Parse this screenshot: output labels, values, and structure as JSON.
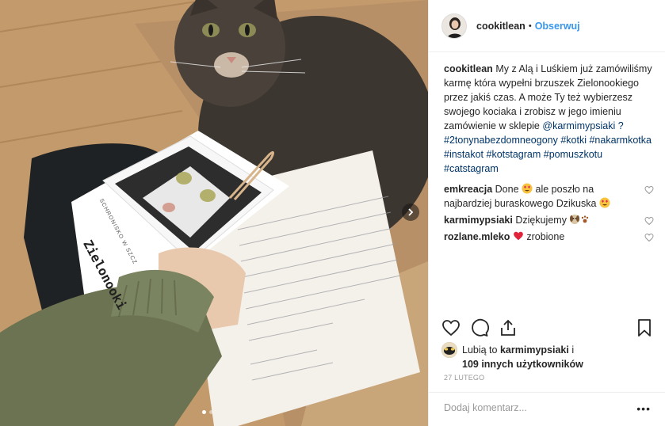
{
  "post": {
    "username": "cookitlean",
    "separator": "•",
    "follow_label": "Obserwuj",
    "caption_author": "cookitlean",
    "caption_text": "My z Alą i Luśkiem już zamówiliśmy karmę która wypełni brzuszek Zielonookiego przez jakiś czas. A może Ty też wybierzesz swojego kociaka i zrobisz w jego imieniu zamówienie w sklepie",
    "caption_tags": "@karmimypsiaki ? #2tonynabezdomneogony #kotki #nakarmkotka #instakot #kotstagram #pomuszkotu #catstagram"
  },
  "photo": {
    "card_title": "Zielonooki",
    "card_subtitle": "SCHRONISKO W SZCZ"
  },
  "comments": [
    {
      "author": "emkreacja",
      "text_before": "Done",
      "emoji1": "heart-eyes",
      "text_after": "ale poszło na najbardziej buraskowego Dzikuska",
      "emoji2": "heart-eyes"
    },
    {
      "author": "karmimypsiaki",
      "text": "Dziękujemy",
      "emoji": "dog-paws"
    },
    {
      "author": "rozlane.mleko",
      "emoji": "red-heart",
      "text": "zrobione"
    }
  ],
  "likes": {
    "prefix": "Lubią to",
    "user": "karmimypsiaki",
    "middle": "i",
    "count_text": "109 innych użytkowników"
  },
  "date": "27 LUTEGO",
  "add_comment_placeholder": "Dodaj komentarz...",
  "more_label": "•••",
  "colors": {
    "link": "#3897f0",
    "hashtag": "#003569",
    "text": "#262626",
    "muted": "#999999",
    "like_red": "#ed4956"
  }
}
